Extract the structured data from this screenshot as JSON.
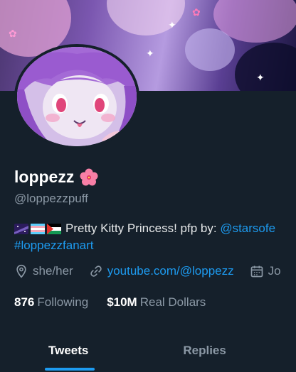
{
  "profile": {
    "display_name": "loppezz",
    "name_emoji": "hibiscus-flower-icon",
    "handle": "@loppezzpuff",
    "bio_text": "Pretty Kitty Princess! pfp by: ",
    "bio_mention": "@starsofe",
    "bio_hashtag": "#loppezzfanart",
    "bio_flags": [
      "milky-way-emoji-icon",
      "transgender-flag-icon",
      "palestine-flag-icon"
    ]
  },
  "meta": {
    "location": "she/her",
    "website": "youtube.com/@loppezz",
    "joined_partial": "Jo"
  },
  "stats": {
    "following_count": "876",
    "following_label": "Following",
    "followers_count": "$10M",
    "followers_label": "Real Dollars"
  },
  "tabs": [
    {
      "label": "Tweets",
      "active": true
    },
    {
      "label": "Replies",
      "active": false
    }
  ],
  "colors": {
    "background": "#15202b",
    "accent": "#1d9bf0",
    "secondary_text": "#8b98a5"
  }
}
